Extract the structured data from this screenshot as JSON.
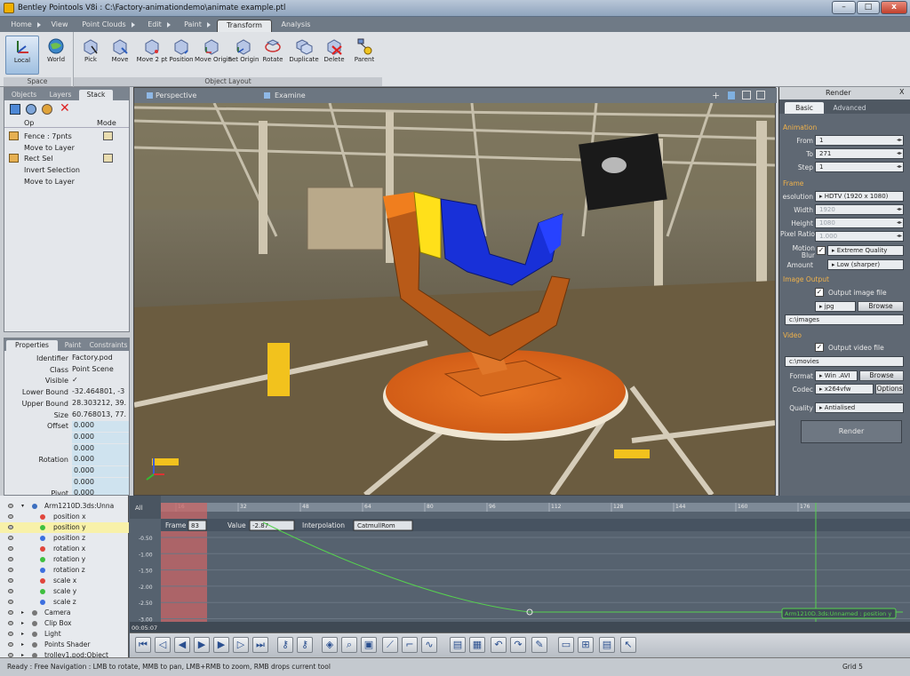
{
  "window": {
    "title": "Bentley Pointools V8i : C:\\Factory-animationdemo\\animate example.ptl",
    "min_label": "–",
    "max_label": "□",
    "close_label": "x"
  },
  "ribbon_tabs": [
    {
      "label": "Home",
      "active": false
    },
    {
      "label": "View",
      "active": false
    },
    {
      "label": "Point Clouds",
      "active": false
    },
    {
      "label": "Edit",
      "active": false
    },
    {
      "label": "Paint",
      "active": false
    },
    {
      "label": "Transform",
      "active": true
    },
    {
      "label": "Analysis",
      "active": false
    }
  ],
  "ribbon": {
    "space_group": {
      "label": "Space",
      "buttons": [
        "Local",
        "World"
      ]
    },
    "layout_group": {
      "label": "Object Layout",
      "buttons": [
        "Pick",
        "Move",
        "Move 2 pt",
        "Position",
        "Move Origin",
        "Set Origin",
        "Rotate",
        "Duplicate",
        "Delete",
        "Parent"
      ]
    }
  },
  "left_top": {
    "tabs": [
      "Objects",
      "Layers",
      "Stack"
    ],
    "active_tab": "Stack",
    "columns": [
      "Op",
      "Mode"
    ],
    "items": [
      "Fence : 7pnts",
      "Move to Layer",
      "Rect Sel",
      "Invert Selection",
      "Move to Layer"
    ]
  },
  "properties": {
    "tabs": [
      "Properties",
      "Paint",
      "Constraints"
    ],
    "rows": [
      {
        "label": "Identifier",
        "value": "Factory.pod"
      },
      {
        "label": "Class",
        "value": "Point Scene"
      },
      {
        "label": "Visible",
        "value": "✓"
      },
      {
        "label": "Lower Bound",
        "value": "-32.464801, -3"
      },
      {
        "label": "Upper Bound",
        "value": "28.303212, 39."
      },
      {
        "label": "Size",
        "value": "60.768013, 77."
      },
      {
        "label": "Offset",
        "value": "0.000"
      },
      {
        "label": "",
        "value": "0.000"
      },
      {
        "label": "",
        "value": "0.000"
      },
      {
        "label": "Rotation",
        "value": "0.000"
      },
      {
        "label": "",
        "value": "0.000"
      },
      {
        "label": "",
        "value": "0.000"
      },
      {
        "label": "Pivot",
        "value": "0.000"
      }
    ]
  },
  "viewport": {
    "modes": [
      "Perspective",
      "Examine"
    ]
  },
  "render": {
    "title": "Render",
    "tabs": [
      "Basic",
      "Advanced"
    ],
    "sections": {
      "animation": "Animation",
      "frame": "Frame",
      "image_output": "Image Output",
      "video": "Video"
    },
    "from": "1",
    "to": "271",
    "step": "1",
    "resolution_label": "esolution",
    "resolution": "HDTV (1920 x 1080)",
    "width": "1920",
    "height": "1080",
    "pixel_ratio_label": "Pixel Ratio",
    "pixel_ratio": "1.000",
    "motion_blur_label": "Motion Blur",
    "motion_blur": "Extreme Quality",
    "amount": "Low (sharper)",
    "output_image_file": "Output image file",
    "image_format": "jpg",
    "browse": "Browse",
    "image_path": "c:\\images",
    "output_video_file": "Output video file",
    "video_path": "c:\\movies",
    "format": "Win .AVI",
    "codec": "x264vfw",
    "options": "Options",
    "quality": "Antialised",
    "render_button": "Render",
    "labels": {
      "from": "From",
      "to": "To",
      "step": "Step",
      "width": "Width",
      "height": "Height",
      "amount": "Amount",
      "format": "Format",
      "codec": "Codec",
      "quality": "Quality"
    }
  },
  "tree": {
    "items": [
      {
        "label": "Arm1210D.3ds:Unna",
        "color": "#3c6fbf",
        "selected": false
      },
      {
        "label": "position x",
        "color": "#e0463c",
        "selected": false
      },
      {
        "label": "position y",
        "color": "#3fbf3f",
        "selected": true
      },
      {
        "label": "position z",
        "color": "#3c6fdf",
        "selected": false
      },
      {
        "label": "rotation x",
        "color": "#e0463c",
        "selected": false
      },
      {
        "label": "rotation y",
        "color": "#3fbf3f",
        "selected": false
      },
      {
        "label": "rotation z",
        "color": "#3c6fdf",
        "selected": false
      },
      {
        "label": "scale x",
        "color": "#e0463c",
        "selected": false
      },
      {
        "label": "scale y",
        "color": "#3fbf3f",
        "selected": false
      },
      {
        "label": "scale z",
        "color": "#3c6fdf",
        "selected": false
      },
      {
        "label": "Camera",
        "color": "#777777",
        "selected": false
      },
      {
        "label": "Clip Box",
        "color": "#777777",
        "selected": false
      },
      {
        "label": "Light",
        "color": "#777777",
        "selected": false
      },
      {
        "label": "Points Shader",
        "color": "#777777",
        "selected": false
      },
      {
        "label": "trolley1.pod:Object",
        "color": "#777777",
        "selected": false
      }
    ]
  },
  "timeline": {
    "all_label": "All",
    "frame_label": "Frame",
    "frame": "83",
    "value_label": "Value",
    "value": "-2.87",
    "interpolation_label": "Interpolation",
    "interpolation": "CatmullRom",
    "ticks": [
      "16",
      "32",
      "48",
      "64",
      "80",
      "96",
      "112",
      "128",
      "144",
      "160",
      "176"
    ],
    "y_ticks": [
      "-0.50",
      "-1.00",
      "-1.50",
      "-2.00",
      "-2.50",
      "-3.00"
    ],
    "time": "00:05:07",
    "curve_label": "Arm1210D.3ds:Unnamed : position y"
  },
  "status": {
    "message": "Ready : Free Navigation : LMB to rotate, MMB to pan, LMB+RMB to zoom, RMB drops current tool",
    "grid": "Grid 5"
  },
  "colors": {
    "accent_orange": "#f1b24a",
    "panel_dark": "#5f6873",
    "curve_green": "#56d24f"
  }
}
